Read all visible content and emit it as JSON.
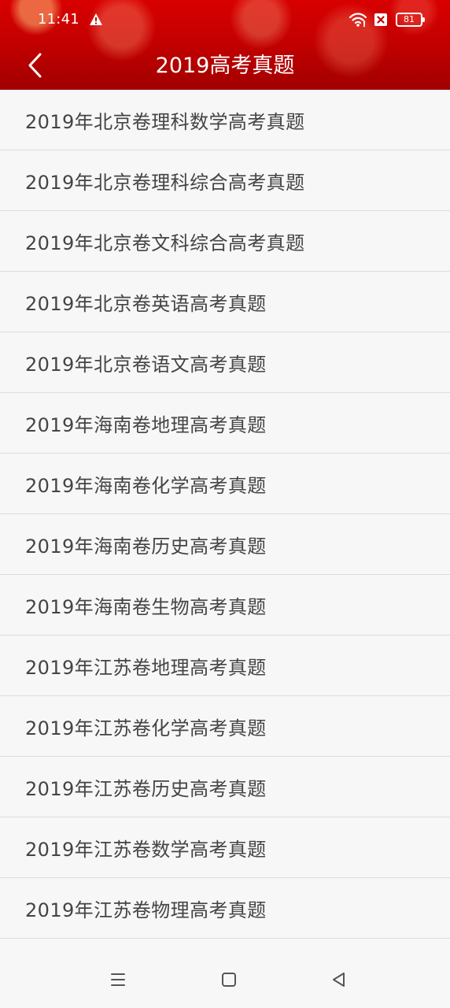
{
  "status_bar": {
    "time": "11:41",
    "battery": "81"
  },
  "header": {
    "title": "2019高考真题"
  },
  "list": {
    "items": [
      "2019年北京卷理科数学高考真题",
      "2019年北京卷理科综合高考真题",
      "2019年北京卷文科综合高考真题",
      "2019年北京卷英语高考真题",
      "2019年北京卷语文高考真题",
      "2019年海南卷地理高考真题",
      "2019年海南卷化学高考真题",
      "2019年海南卷历史高考真题",
      "2019年海南卷生物高考真题",
      "2019年江苏卷地理高考真题",
      "2019年江苏卷化学高考真题",
      "2019年江苏卷历史高考真题",
      "2019年江苏卷数学高考真题",
      "2019年江苏卷物理高考真题"
    ]
  },
  "icons": {
    "back": "chevron-left-icon",
    "warning": "warning-icon",
    "wifi": "wifi-icon",
    "x_box": "x-box-icon",
    "menu": "menu-icon",
    "home": "home-square-icon",
    "nav_back": "triangle-back-icon"
  },
  "colors": {
    "header_red": "#c30000",
    "header_text": "#ffffff",
    "list_background": "#f7f7f7",
    "list_text": "#444444",
    "divider": "#dddddd"
  }
}
